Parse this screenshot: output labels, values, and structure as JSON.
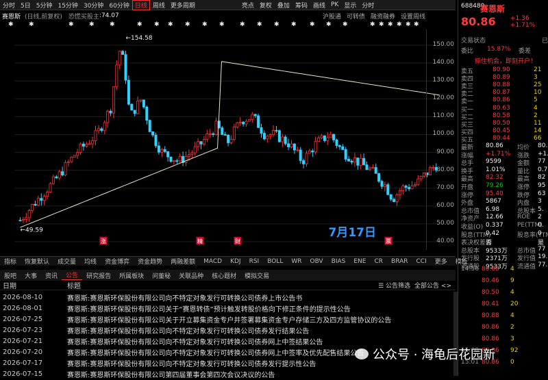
{
  "toolbar": {
    "items": [
      "分时",
      "5日",
      "5分钟",
      "15分钟",
      "30分钟",
      "60分钟",
      "日线",
      "周线",
      "更多周期",
      "亮点",
      "复权",
      "叠加",
      "筹码",
      "画线",
      "PK",
      "显示",
      "分时"
    ],
    "active": "日线"
  },
  "subhead": {
    "name": "赛恩斯",
    "mode": "(日线,前复权)",
    "indicator": "恐慌买股主",
    "value": ":74.07",
    "right_links": [
      "沪股通",
      "可转债",
      "融资融券",
      "设置周线"
    ]
  },
  "chart": {
    "peak_label": "154.58",
    "low_label": "49.59",
    "date_annotation": "7月17日",
    "markers": [
      "涨",
      "精",
      "财",
      "票"
    ],
    "yticks": [
      "150.00",
      "140.00",
      "130.00",
      "120.00",
      "110.00",
      "100.00",
      "90.00",
      "80.00",
      "70.00",
      "60.00",
      "50.00",
      "40.00"
    ]
  },
  "indicator_tabs": [
    "指标",
    "恢复默认",
    "成交量",
    "均线",
    "资金博弈",
    "资金趋势",
    "两融差额",
    "MACD",
    "KDJ",
    "RSI",
    "BOLL",
    "WR",
    "OBV",
    "BIAS",
    "ENE",
    "CR",
    "BRAR",
    "CCI",
    "更多",
    "模板"
  ],
  "news_tabs": [
    "股吧",
    "大事",
    "资讯",
    "公告",
    "研究报告",
    "所属板块",
    "问董秘",
    "关联品种",
    "核心题材",
    "模拟交易"
  ],
  "news_active": "公告",
  "news_header": {
    "date": "日期",
    "title": "标题",
    "filter": "公告筛选",
    "open": "全部公告"
  },
  "news": [
    {
      "date": "2026-08-10",
      "title": "赛恩斯:赛恩斯环保股份有限公司向不特定对象发行可转换公司债券上市公告书"
    },
    {
      "date": "2026-08-01",
      "title": "赛恩斯:赛恩斯环保股份有限公司关于“赛恩转债”预计触发转股价格向下修正条件的提示性公告"
    },
    {
      "date": "2026-07-25",
      "title": "赛恩斯:赛恩斯环保股份有限公司关于开立募集资金专户并签署募集资金专户存储三方及四方监管协议的公告"
    },
    {
      "date": "2026-07-23",
      "title": "赛恩斯:赛恩斯环保股份有限公司向不特定对象发行可转换公司债券发行结果公告"
    },
    {
      "date": "2026-07-21",
      "title": "赛恩斯:赛恩斯环保股份有限公司向不特定对象发行可转换公司债券网上中签结果公告"
    },
    {
      "date": "2026-07-20",
      "title": "赛恩斯:赛恩斯环保股份有限公司向不特定对象发行可转换公司债券网上中签率及优先配售结果公告"
    },
    {
      "date": "2026-07-17",
      "title": "赛恩斯:赛恩斯环保股份有限公司向不特定对象发行可转换公司债券发行提示性公告"
    },
    {
      "date": "2026-07-15",
      "title": "赛恩斯:赛恩斯环保股份有限公司第四届董事会第四次会议决议的公告"
    }
  ],
  "quote": {
    "code": "688480",
    "name": "赛恩斯",
    "price": "80.86",
    "change": "+1.36",
    "pct": "+1.71%",
    "status_label": "交易状态",
    "status_val": "已",
    "webi_label": "委比",
    "webi": "15.87%",
    "weicha_label": "委差",
    "ad": "抓住机会，即刻开户！",
    "asks": [
      [
        "卖五",
        "80.90",
        "21"
      ],
      [
        "卖四",
        "80.89",
        "3"
      ],
      [
        "卖三",
        "80.88",
        "25"
      ],
      [
        "卖二",
        "80.87",
        "10"
      ],
      [
        "卖一",
        "80.86",
        "5"
      ]
    ],
    "bids": [
      [
        "买一",
        "80.63",
        "4"
      ],
      [
        "买二",
        "80.58",
        "2"
      ],
      [
        "买三",
        "80.50",
        "11"
      ],
      [
        "买四",
        "80.45",
        "14"
      ],
      [
        "买五",
        "80.44",
        "66"
      ]
    ],
    "stats": [
      [
        "最新",
        "80.86",
        "均价",
        "80.9"
      ],
      [
        "涨幅",
        "+1.71%",
        "涨跌",
        "+1.3"
      ],
      [
        "总手",
        "9599",
        "金额",
        "77"
      ],
      [
        "换手",
        "1.01%",
        "量比",
        "0.7"
      ],
      [
        "最高",
        "82.32",
        "最高",
        "82"
      ],
      [
        "开盘",
        "79.26",
        "涨停",
        "95"
      ],
      [
        "涨停",
        "95.40",
        "跌停",
        "63"
      ],
      [
        "外盘",
        "5867",
        "内盘",
        "3"
      ],
      [
        "总市值",
        "6.98",
        "总股本",
        "5."
      ],
      [
        "净资产",
        "12.66",
        "ROE",
        "2"
      ],
      [
        "收益(O)",
        "0.337",
        "PE(TTM)",
        "0."
      ],
      [
        "股息(TTM)",
        "0.42",
        "股息率(TTM)",
        "0"
      ],
      [
        "表决权差异",
        "否",
        "",
        "是"
      ],
      [
        "总股本",
        "9533万",
        "总市值",
        "77"
      ],
      [
        "发行股",
        "2371万",
        "发行值",
        "19."
      ],
      [
        "流通股",
        "9533万",
        "流通值",
        "77."
      ]
    ],
    "ticks": [
      [
        "14:56",
        "80.88",
        "4"
      ],
      [
        "",
        "80.46",
        "9"
      ],
      [
        "",
        "80.50",
        "4"
      ],
      [
        "",
        "80.41",
        "20"
      ],
      [
        "",
        "80.88",
        "4"
      ],
      [
        "",
        "80.86",
        "2"
      ],
      [
        "",
        "80.86",
        "3"
      ],
      [
        "15:00",
        "80.86",
        "92"
      ],
      [
        "15:01",
        "80.86",
        "0"
      ]
    ]
  },
  "watermark": "公众号 · 海龟后花园新"
}
